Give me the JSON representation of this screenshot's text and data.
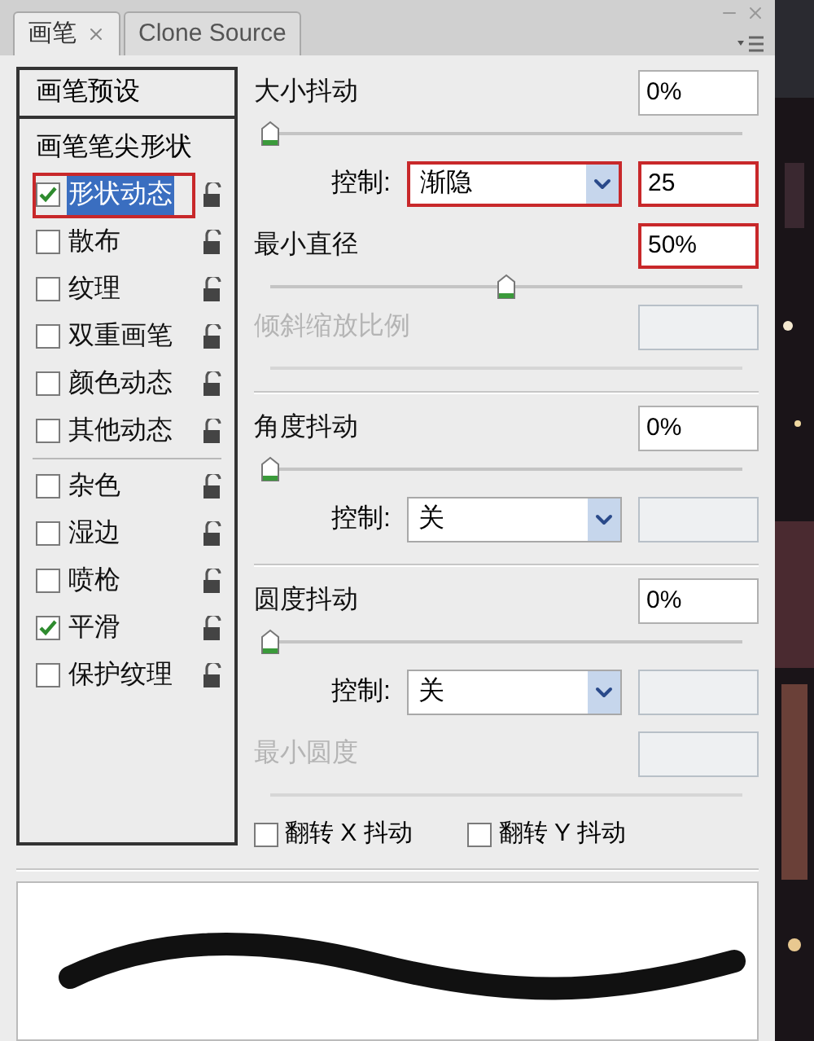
{
  "tabs": [
    {
      "label": "画笔",
      "selected": true,
      "closable": true
    },
    {
      "label": "Clone Source",
      "selected": false,
      "closable": false
    }
  ],
  "presets_header": "画笔预设",
  "tip_shape": "画笔笔尖形状",
  "options": [
    {
      "kind": "option",
      "label": "形状动态",
      "checked": true,
      "selected": true,
      "highlighted": true
    },
    {
      "kind": "option",
      "label": "散布",
      "checked": false,
      "selected": false,
      "highlighted": false
    },
    {
      "kind": "option",
      "label": "纹理",
      "checked": false,
      "selected": false,
      "highlighted": false
    },
    {
      "kind": "option",
      "label": "双重画笔",
      "checked": false,
      "selected": false,
      "highlighted": false
    },
    {
      "kind": "option",
      "label": "颜色动态",
      "checked": false,
      "selected": false,
      "highlighted": false
    },
    {
      "kind": "option",
      "label": "其他动态",
      "checked": false,
      "selected": false,
      "highlighted": false
    },
    {
      "kind": "divider"
    },
    {
      "kind": "option",
      "label": "杂色",
      "checked": false,
      "selected": false,
      "highlighted": false
    },
    {
      "kind": "option",
      "label": "湿边",
      "checked": false,
      "selected": false,
      "highlighted": false
    },
    {
      "kind": "option",
      "label": "喷枪",
      "checked": false,
      "selected": false,
      "highlighted": false
    },
    {
      "kind": "option",
      "label": "平滑",
      "checked": true,
      "selected": false,
      "highlighted": false
    },
    {
      "kind": "option",
      "label": "保护纹理",
      "checked": false,
      "selected": false,
      "highlighted": false
    }
  ],
  "settings": [
    {
      "kind": "slider",
      "label": "大小抖动",
      "value": "0%",
      "level": 0,
      "disabled": false,
      "highlighted": false
    },
    {
      "kind": "control",
      "label": "控制:",
      "option": "渐隐",
      "value": "25",
      "field_disabled": false,
      "dropdown_highlighted": true,
      "field_highlighted": true
    },
    {
      "kind": "slider",
      "label": "最小直径",
      "value": "50%",
      "level": 0.5,
      "disabled": false,
      "highlighted": true
    },
    {
      "kind": "slider",
      "label": "倾斜缩放比例",
      "disabled": true,
      "highlighted": false
    },
    {
      "kind": "divider"
    },
    {
      "kind": "slider",
      "label": "角度抖动",
      "value": "0%",
      "level": 0,
      "disabled": false,
      "highlighted": false
    },
    {
      "kind": "control",
      "label": "控制:",
      "option": "关",
      "field_disabled": true,
      "dropdown_highlighted": false,
      "field_highlighted": false
    },
    {
      "kind": "divider"
    },
    {
      "kind": "slider",
      "label": "圆度抖动",
      "value": "0%",
      "level": 0,
      "disabled": false,
      "highlighted": false
    },
    {
      "kind": "control",
      "label": "控制:",
      "option": "关",
      "field_disabled": true,
      "dropdown_highlighted": false,
      "field_highlighted": false
    },
    {
      "kind": "slider",
      "label": "最小圆度",
      "disabled": true,
      "highlighted": false
    }
  ],
  "flips": [
    {
      "label": "翻转 X 抖动",
      "checked": false
    },
    {
      "label": "翻转 Y 抖动",
      "checked": false
    }
  ]
}
